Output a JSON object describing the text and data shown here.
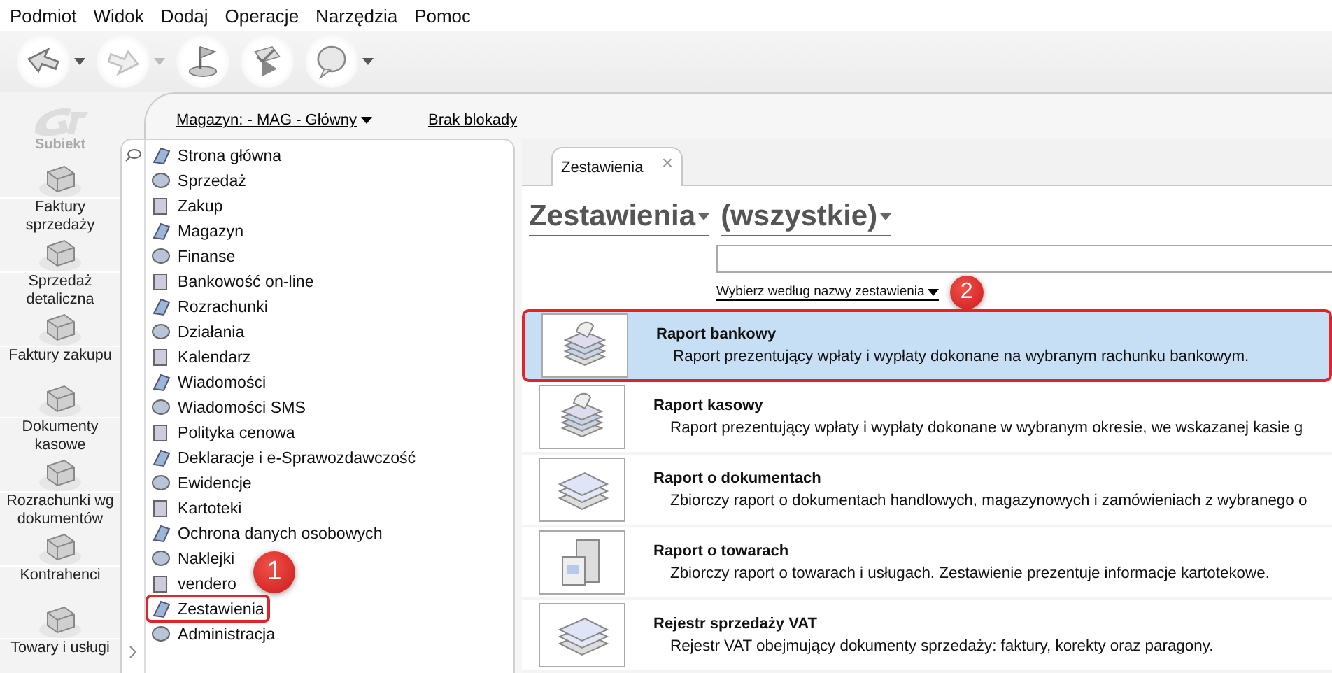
{
  "menu": [
    "Podmiot",
    "Widok",
    "Dodaj",
    "Operacje",
    "Narzędzia",
    "Pomoc"
  ],
  "toolbar": [
    {
      "kind": "back",
      "dropdown": true,
      "disabled": false
    },
    {
      "kind": "forward",
      "dropdown": true,
      "disabled": true
    },
    {
      "kind": "flag",
      "dropdown": false,
      "disabled": false
    },
    {
      "kind": "check",
      "dropdown": false,
      "disabled": false
    },
    {
      "kind": "help",
      "dropdown": true,
      "disabled": false
    }
  ],
  "sidebar": {
    "logo": "Subiekt",
    "items": [
      {
        "label": "Faktury sprzedaży"
      },
      {
        "label": "Sprzedaż detaliczna"
      },
      {
        "label": "Faktury zakupu"
      },
      {
        "label": "Dokumenty kasowe"
      },
      {
        "label": "Rozrachunki wg dokumentów"
      },
      {
        "label": "Kontrahenci"
      },
      {
        "label": "Towary i usługi"
      }
    ]
  },
  "header": {
    "warehouse": "Magazyn: - MAG - Główny",
    "lock": "Brak blokady"
  },
  "nav": {
    "items": [
      {
        "label": "Strona główna",
        "framed": false
      },
      {
        "label": "Sprzedaż",
        "framed": false
      },
      {
        "label": "Zakup",
        "framed": false
      },
      {
        "label": "Magazyn",
        "framed": false
      },
      {
        "label": "Finanse",
        "framed": false
      },
      {
        "label": "Bankowość on-line",
        "framed": false
      },
      {
        "label": "Rozrachunki",
        "framed": false
      },
      {
        "label": "Działania",
        "framed": false
      },
      {
        "label": "Kalendarz",
        "framed": false
      },
      {
        "label": "Wiadomości",
        "framed": false
      },
      {
        "label": "Wiadomości SMS",
        "framed": false
      },
      {
        "label": "Polityka cenowa",
        "framed": false
      },
      {
        "label": "Deklaracje i e-Sprawozdawczość",
        "framed": false
      },
      {
        "label": "Ewidencje",
        "framed": false
      },
      {
        "label": "Kartoteki",
        "framed": false
      },
      {
        "label": "Ochrona danych osobowych",
        "framed": false
      },
      {
        "label": "Naklejki",
        "framed": false
      },
      {
        "label": "vendero",
        "framed": false
      },
      {
        "label": "Zestawienia",
        "framed": true
      },
      {
        "label": "Administracja",
        "framed": false
      }
    ],
    "callout": "1"
  },
  "tab": {
    "label": "Zestawienia",
    "close": "×"
  },
  "title": {
    "group": "Zestawienia",
    "filter": "(wszystkie)"
  },
  "search": {
    "hint": "Wybierz według nazwy zestawienia",
    "callout": "2"
  },
  "reports": [
    {
      "kind": "money",
      "title": "Raport bankowy",
      "description": "Raport prezentujący wpłaty i wypłaty dokonane na wybranym rachunku bankowym.",
      "selected": true,
      "framed": true
    },
    {
      "kind": "money",
      "title": "Raport kasowy",
      "description": "Raport prezentujący wpłaty i wypłaty dokonane w wybranym okresie, we wskazanej kasie g",
      "selected": false,
      "framed": false
    },
    {
      "kind": "papers",
      "title": "Raport o dokumentach",
      "description": "Zbiorczy raport o dokumentach handlowych, magazynowych i zamówieniach z wybranego o",
      "selected": false,
      "framed": false
    },
    {
      "kind": "boxes",
      "title": "Raport o towarach",
      "description": "Zbiorczy raport o towarach i usługach. Zestawienie prezentuje informacje kartotekowe.",
      "selected": false,
      "framed": false
    },
    {
      "kind": "papers",
      "title": "Rejestr sprzedaży VAT",
      "description": "Rejestr VAT obejmujący dokumenty sprzedaży: faktury, korekty oraz paragony.",
      "selected": false,
      "framed": false
    }
  ]
}
